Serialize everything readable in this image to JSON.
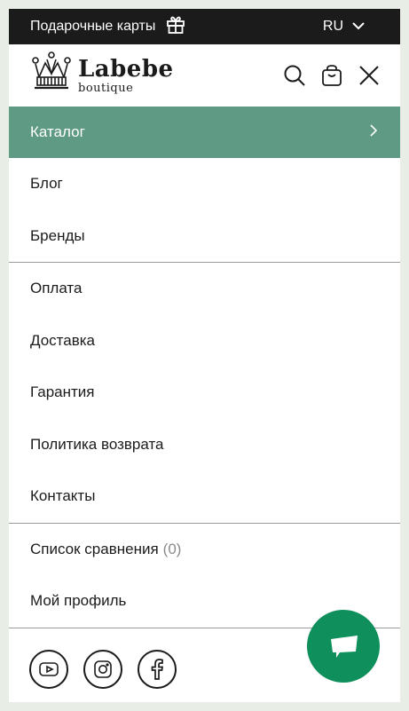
{
  "topbar": {
    "gift_cards_label": "Подарочные карты",
    "language": "RU"
  },
  "brand": {
    "name": "Labebe",
    "sub": "boutique"
  },
  "menu": {
    "catalog": "Каталог",
    "group1": [
      "Блог",
      "Бренды"
    ],
    "group2": [
      "Оплата",
      "Доставка",
      "Гарантия",
      "Политика возврата",
      "Контакты"
    ],
    "compare_label": "Список сравнения",
    "compare_count": "(0)",
    "profile": "Мой профиль"
  },
  "colors": {
    "topbar_bg": "#1b1b1b",
    "catalog_bg": "#5f9a85",
    "chat_bg": "#0e8f5b"
  },
  "icons": [
    "gift-icon",
    "chevron-down-icon",
    "search-icon",
    "bag-icon",
    "close-icon",
    "chevron-right-icon",
    "youtube-icon",
    "instagram-icon",
    "facebook-icon",
    "chat-icon"
  ]
}
